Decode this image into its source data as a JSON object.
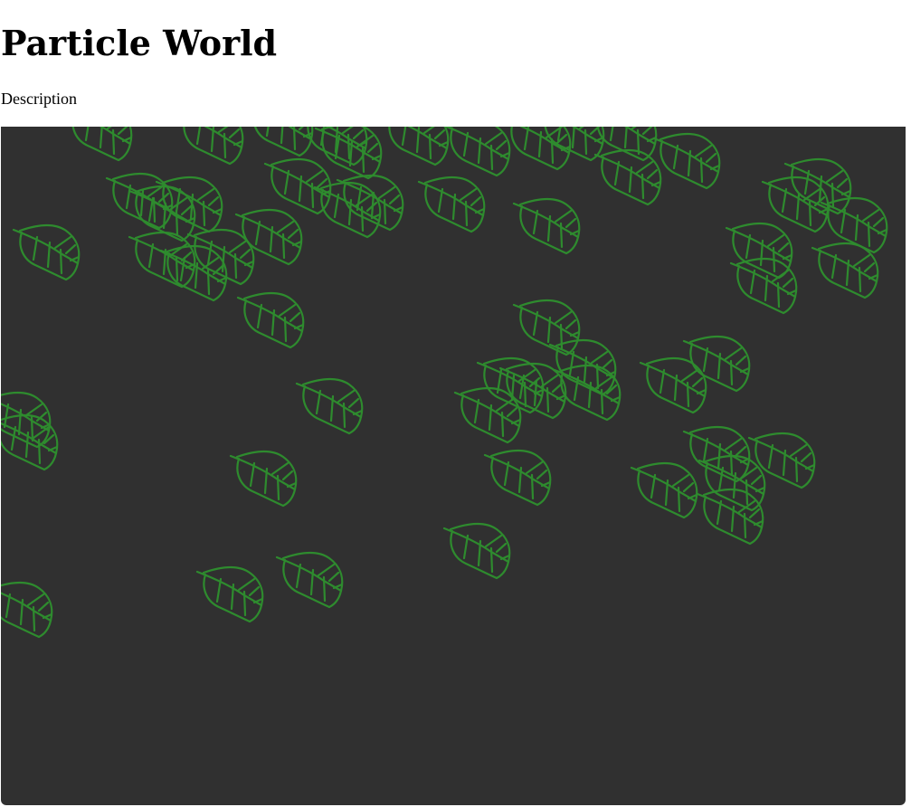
{
  "page": {
    "title": "Particle World",
    "description": "Description"
  },
  "canvas": {
    "background_color": "#303030",
    "particle_stroke_color": "#2e8b2e",
    "particle_icon": "leaf-icon"
  }
}
